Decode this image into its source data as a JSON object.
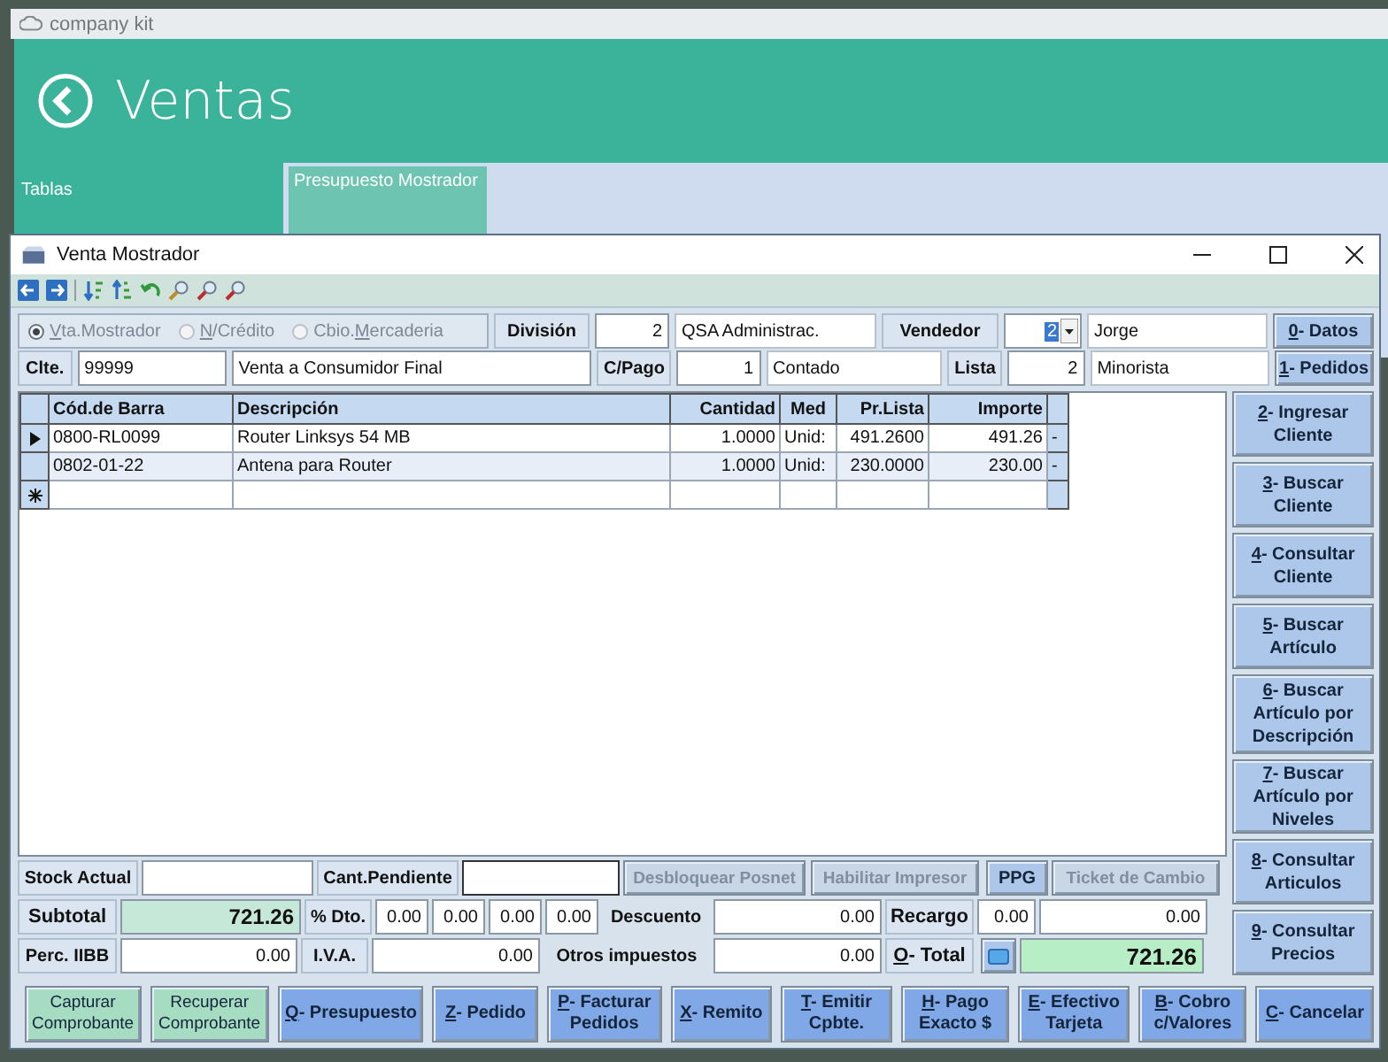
{
  "app": {
    "title": "company kit",
    "heading": "Ventas",
    "sidebar_label": "Tablas",
    "tiles": [
      {
        "label": "Presupuesto Mostrador"
      }
    ]
  },
  "dialog": {
    "title": "Venta Mostrador",
    "sale_type": [
      {
        "key": "V",
        "post": "ta.Mostrador",
        "selected": true,
        "disabled": true
      },
      {
        "key": "N",
        "post": "/Crédito",
        "selected": false,
        "disabled": true
      },
      {
        "pre": "Cbio.",
        "key": "M",
        "post": "ercaderia",
        "selected": false,
        "disabled": true
      }
    ],
    "division": {
      "label": "División",
      "code": "2",
      "name": "QSA Administrac."
    },
    "vendedor": {
      "label": "Vendedor",
      "code": "2",
      "name": "Jorge"
    },
    "cliente": {
      "label": "Clte.",
      "code": "99999",
      "name": "Venta a Consumidor Final"
    },
    "cpago": {
      "label": "C/Pago",
      "code": "1",
      "name": "Contado"
    },
    "lista": {
      "label": "Lista",
      "code": "2",
      "name": "Minorista"
    },
    "top_buttons": [
      {
        "key": "0",
        "label": "- Datos"
      },
      {
        "key": "1",
        "label": "- Pedidos"
      }
    ],
    "table": {
      "columns": [
        "Cód.de Barra",
        "Descripción",
        "Cantidad",
        "Med",
        "Pr.Lista",
        "Importe"
      ],
      "rows": [
        {
          "current": true,
          "cells": [
            "0800-RL0099",
            "Router Linksys 54 MB",
            "1.0000",
            "Unid:",
            "491.2600",
            "491.26",
            "-"
          ]
        },
        {
          "current": false,
          "cells": [
            "0802-01-22",
            "Antena para Router",
            "1.0000",
            "Unid:",
            "230.0000",
            "230.00",
            "-"
          ]
        }
      ]
    },
    "side_buttons": [
      {
        "key": "2",
        "label": "- Ingresar Cliente"
      },
      {
        "key": "3",
        "label": "- Buscar Cliente"
      },
      {
        "key": "4",
        "label": "- Consultar Cliente"
      },
      {
        "key": "5",
        "label": "- Buscar Artículo"
      },
      {
        "key": "6",
        "label": "- Buscar Artículo por Descripción"
      },
      {
        "key": "7",
        "label": "- Buscar Artículo por Niveles"
      },
      {
        "key": "8",
        "label": "- Consultar Articulos"
      },
      {
        "key": "9",
        "label": "- Consultar Precios"
      }
    ],
    "stock": {
      "label": "Stock Actual",
      "pending_label": "Cant.Pendiente"
    },
    "actions": [
      {
        "label": "Desbloquear Posnet",
        "disabled": true
      },
      {
        "label": "Habilitar Impresor",
        "disabled": true
      },
      {
        "label": "PPG",
        "disabled": false
      },
      {
        "label": "Ticket de Cambio",
        "disabled": true
      }
    ],
    "subtotal": {
      "label": "Subtotal",
      "value": "721.26"
    },
    "discount": {
      "label": "% Dto.",
      "values": [
        "0.00",
        "0.00",
        "0.00",
        "0.00"
      ]
    },
    "descuento": {
      "label": "Descuento",
      "value": "0.00"
    },
    "recargo": {
      "label": "Recargo",
      "percent": "0.00",
      "value": "0.00"
    },
    "perc_iibb": {
      "label": "Perc. IIBB",
      "value": "0.00"
    },
    "iva": {
      "label": "I.V.A.",
      "value": "0.00"
    },
    "otros": {
      "label": "Otros impuestos",
      "value": "0.00"
    },
    "total": {
      "key": "O",
      "label": "- Total",
      "value": "721.26"
    },
    "bottom_buttons": [
      {
        "kind": "secondary",
        "label": "Capturar Comprobante"
      },
      {
        "kind": "secondary",
        "label": "Recuperar Comprobante"
      },
      {
        "kind": "primary",
        "key": "Q",
        "label": "- Presupuesto"
      },
      {
        "kind": "primary",
        "key": "Z",
        "label": "- Pedido"
      },
      {
        "kind": "primary",
        "key": "P",
        "label": "- Facturar Pedidos"
      },
      {
        "kind": "primary",
        "key": "X",
        "label": "- Remito"
      },
      {
        "kind": "primary",
        "key": "T",
        "label": "- Emitir Cpbte."
      },
      {
        "kind": "primary",
        "key": "H",
        "label": "- Pago Exacto $"
      },
      {
        "kind": "primary",
        "key": "E",
        "label": "- Efectivo Tarjeta"
      },
      {
        "kind": "primary",
        "key": "B",
        "label": "- Cobro c/Valores"
      },
      {
        "kind": "primary",
        "key": "C",
        "label": "- Cancelar"
      }
    ]
  }
}
